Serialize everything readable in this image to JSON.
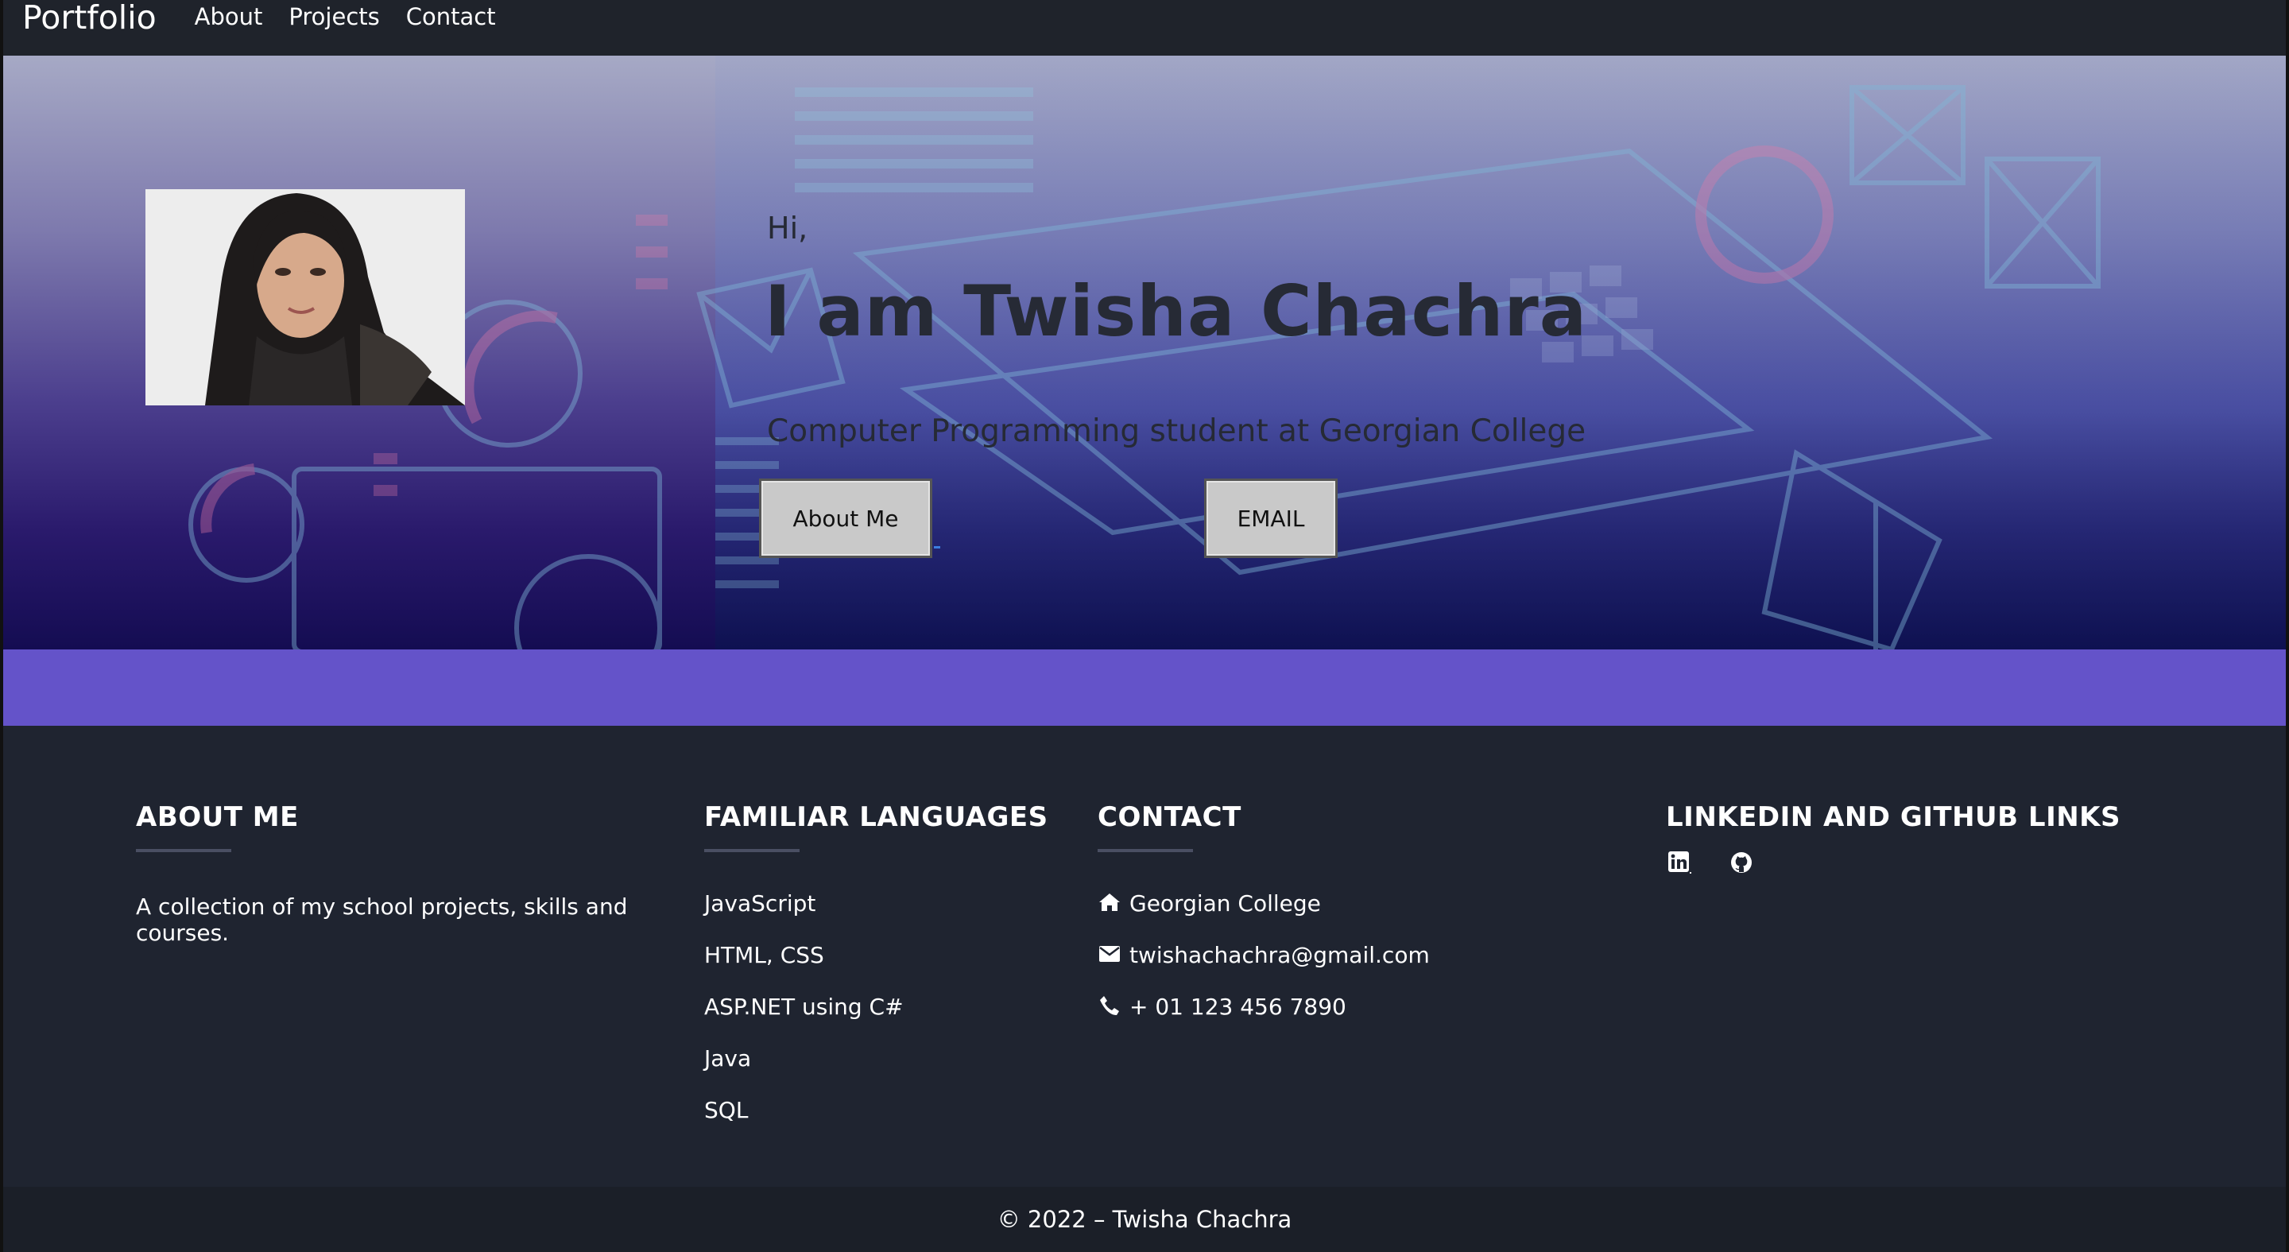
{
  "navbar": {
    "brand": "Portfolio",
    "links": [
      "About",
      "Projects",
      "Contact"
    ]
  },
  "hero": {
    "greeting": "Hi,",
    "name": "I am Twisha Chachra",
    "tagline": "Computer Programming student at Georgian College",
    "about_button": "About Me",
    "email_button": "EMAIL",
    "photo": "profile-photo"
  },
  "footer": {
    "about": {
      "heading": "ABOUT ME",
      "text": "A collection of my school projects, skills and courses."
    },
    "languages": {
      "heading": "FAMILIAR LANGUAGES",
      "items": [
        "JavaScript",
        "HTML, CSS",
        "ASP.NET using C#",
        "Java",
        "SQL"
      ]
    },
    "contact": {
      "heading": "CONTACT",
      "address": "Georgian College",
      "email": "twishachachra@gmail.com",
      "phone": "+ 01 123 456 7890",
      "icons": [
        "home-icon",
        "envelope-icon",
        "phone-icon"
      ]
    },
    "links": {
      "heading": "LINKEDIN AND GITHUB LINKS",
      "icons": [
        "linkedin-icon",
        "github-icon"
      ]
    }
  },
  "copyright": "© 2022 – Twisha Chachra",
  "colors": {
    "navbar": "#1f232b",
    "band": "#6453c9",
    "footer": "#1f2430",
    "hero_text": "#262a35"
  }
}
